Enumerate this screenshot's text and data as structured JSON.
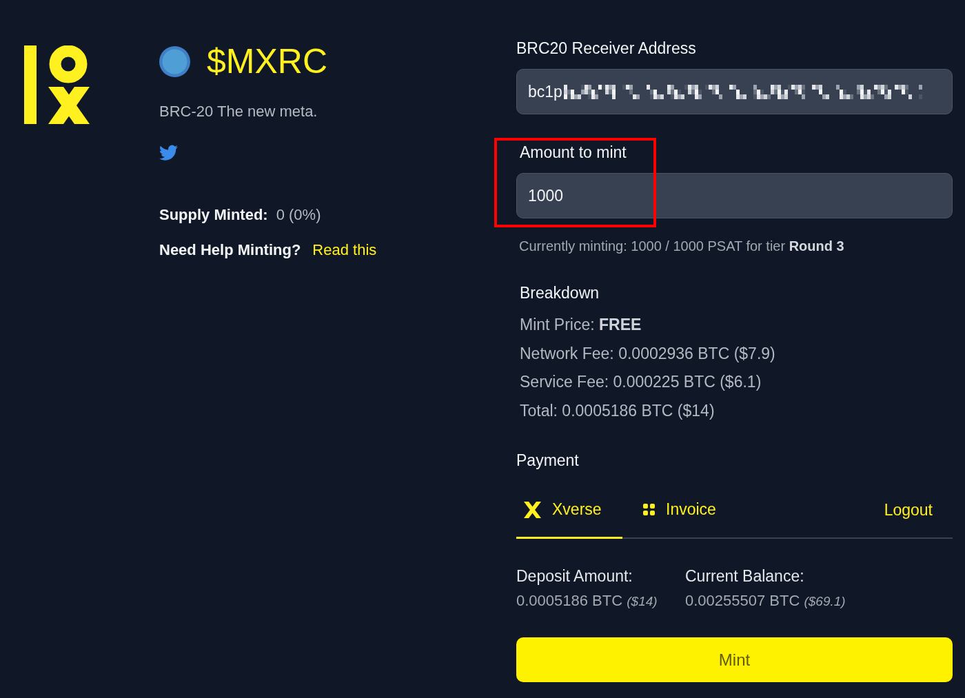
{
  "token": {
    "name": "$MXRC",
    "tagline": "BRC-20 The new meta."
  },
  "stats": [
    {
      "label": "Supply Minted:",
      "value": "0 (0%)"
    }
  ],
  "help": {
    "label": "Need Help Minting?",
    "link": "Read this"
  },
  "form": {
    "address": {
      "label": "BRC20 Receiver Address",
      "value": "bc1p"
    },
    "amount": {
      "label": "Amount to mint",
      "value": "1000",
      "highlighted": true
    },
    "note": "Currently minting: 1000 / 1000 PSAT for tier **Round 3**"
  },
  "breakdown": {
    "title": "Breakdown",
    "lines": [
      "Mint Price: **FREE**",
      "Network Fee: 0.0002936 BTC ($7.9)",
      "Service Fee: 0.000225 BTC ($6.1)",
      "Total: 0.0005186 BTC ($14)"
    ]
  },
  "payment": {
    "title": "Payment",
    "tabs": [
      {
        "label": "Xverse",
        "kind": "wallet",
        "selected": true
      },
      {
        "label": "Invoice",
        "kind": "invoice",
        "selected": false
      }
    ],
    "logout": "Logout",
    "balances": [
      {
        "label": "Deposit Amount:",
        "value": "0.0005186 BTC *($14)*"
      },
      {
        "label": "Current Balance:",
        "value": "0.00255507 BTC *($69.1)*"
      }
    ],
    "submit": "Mint"
  }
}
